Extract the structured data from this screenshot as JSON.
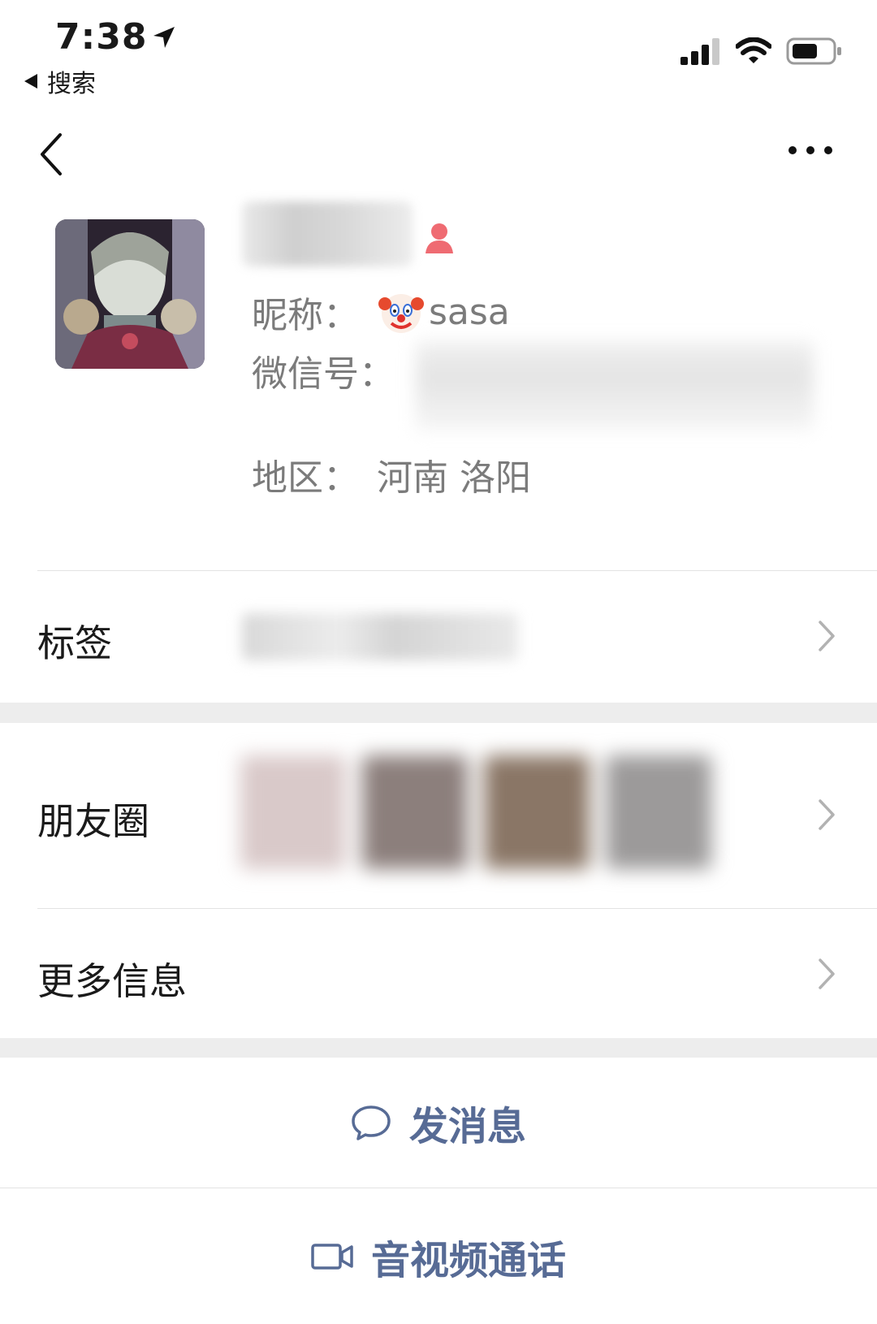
{
  "status_bar": {
    "time": "7:38",
    "back_label": "搜索"
  },
  "profile": {
    "nickname_label": "昵称：",
    "nickname_value": "sasa",
    "wxid_label": "微信号：",
    "region_label": "地区：",
    "region_value": "河南 洛阳"
  },
  "rows": {
    "tags": "标签",
    "moments": "朋友圈",
    "more_info": "更多信息"
  },
  "actions": {
    "send_message": "发消息",
    "av_call": "音视频通话"
  },
  "colors": {
    "link": "#576b95",
    "female": "#ef6b72",
    "background": "#ededed"
  }
}
